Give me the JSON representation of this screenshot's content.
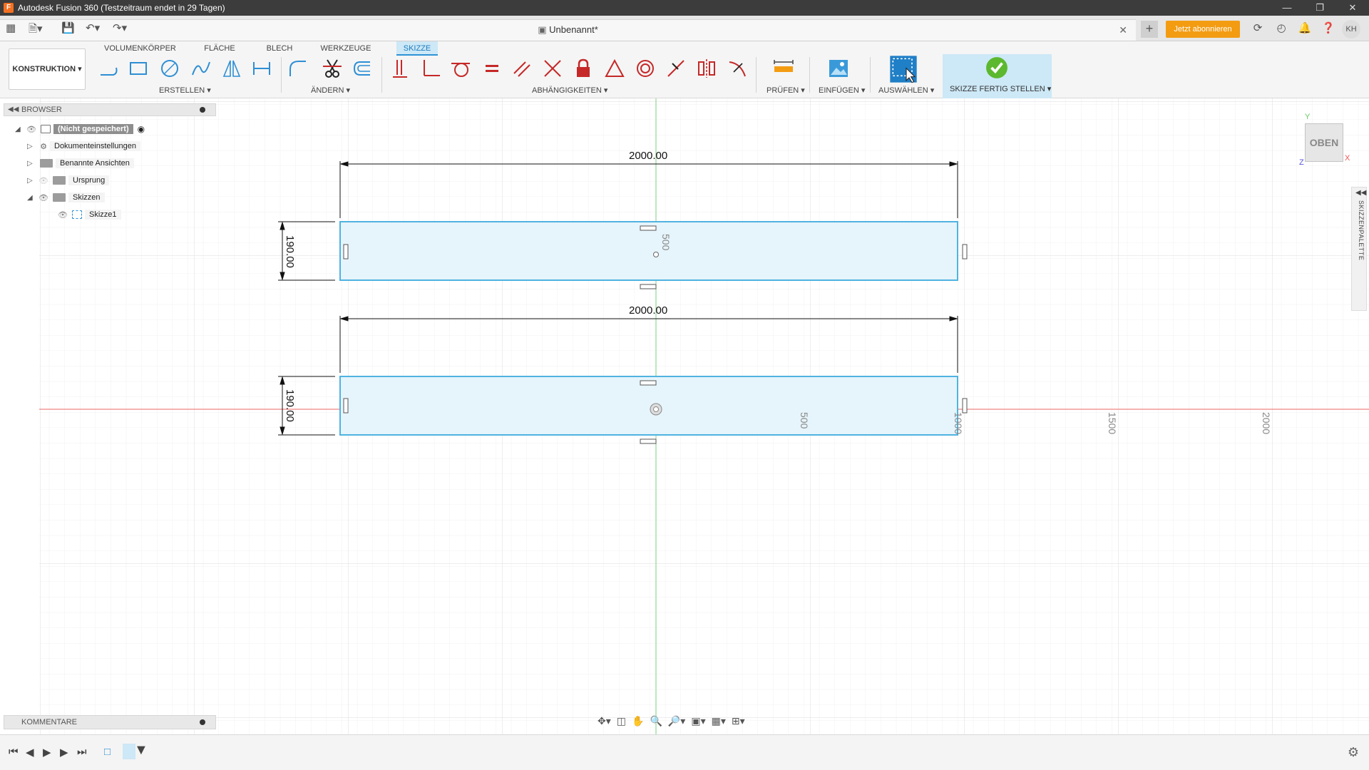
{
  "window": {
    "title": "Autodesk Fusion 360 (Testzeitraum endet in 29 Tagen)",
    "app_icon": "F"
  },
  "appbar": {
    "document_name": "Unbenannt*",
    "subscribe_label": "Jetzt abonnieren",
    "avatar_initials": "KH"
  },
  "toolbar": {
    "workspace": "KONSTRUKTION ▾",
    "tabs": [
      "VOLUMENKÖRPER",
      "FLÄCHE",
      "BLECH",
      "WERKZEUGE",
      "SKIZZE"
    ],
    "active_tab": "SKIZZE",
    "groups": {
      "create": "ERSTELLEN ▾",
      "modify": "ÄNDERN ▾",
      "constraints": "ABHÄNGIGKEITEN ▾",
      "inspect": "PRÜFEN ▾",
      "insert": "EINFÜGEN ▾",
      "select": "AUSWÄHLEN ▾",
      "finish": "SKIZZE FERTIG STELLEN ▾"
    },
    "accent_color": "#2d93d7",
    "finish_color": "#5cb82e"
  },
  "browser": {
    "header": "BROWSER",
    "items": [
      {
        "label": "(Nicht gespeichert)"
      },
      {
        "label": "Dokumenteinstellungen"
      },
      {
        "label": "Benannte Ansichten"
      },
      {
        "label": "Ursprung"
      },
      {
        "label": "Skizzen"
      },
      {
        "label": "Skizze1"
      }
    ]
  },
  "sketch": {
    "dimensions": {
      "top_width": "2000.00",
      "top_height": "190.00",
      "bottom_width": "2000.00",
      "bottom_height": "190.00"
    },
    "axis_numbers": {
      "y_500": "500",
      "x_500": "500",
      "x_1000": "1000",
      "x_1500": "1500",
      "x_2000": "2000"
    },
    "line_color": "#4fb3e0",
    "fill_color": "#e6f4fb"
  },
  "viewcube": {
    "face": "OBEN",
    "x": "X",
    "y": "Y",
    "z": "Z"
  },
  "palette": {
    "label": "SKIZZENPALETTE"
  },
  "comments": {
    "header": "KOMMENTARE"
  }
}
